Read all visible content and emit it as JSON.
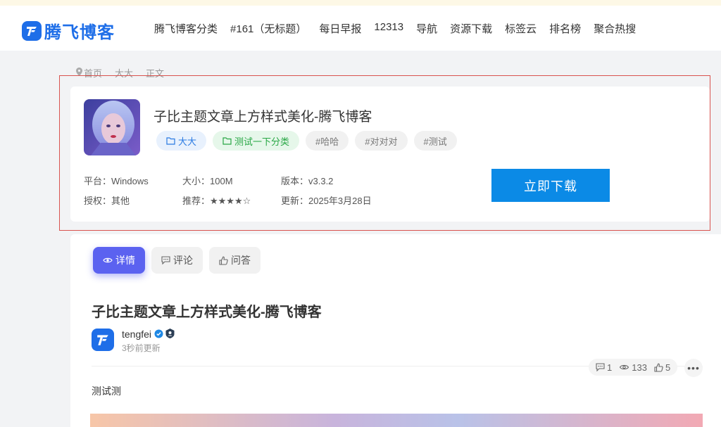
{
  "header": {
    "logo_text": "腾飞博客",
    "nav": [
      "腾飞博客分类",
      "#161（无标题）",
      "每日早报",
      "12313",
      "导航",
      "资源下载",
      "标签云",
      "排名榜",
      "聚合热搜"
    ]
  },
  "breadcrumb": [
    "首页",
    "大大",
    "正文"
  ],
  "download_card": {
    "title": "子比主题文章上方样式美化-腾飞博客",
    "tags": [
      {
        "label": "大大",
        "style": "blue",
        "icon": "folder-icon"
      },
      {
        "label": "测试一下分类",
        "style": "green",
        "icon": "folder-icon"
      },
      {
        "label": "#哈哈",
        "style": "gray"
      },
      {
        "label": "#对对对",
        "style": "gray"
      },
      {
        "label": "#测试",
        "style": "gray"
      }
    ],
    "platform": "平台：Windows",
    "size": "大小：100M",
    "version": "版本：v3.3.2",
    "license": "授权：其他",
    "rating": "推荐：★★★★☆",
    "updated": "更新：2025年3月28日",
    "download_label": "立即下载"
  },
  "article": {
    "tabs": [
      {
        "label": "详情",
        "icon": "eye-icon",
        "active": true
      },
      {
        "label": "评论",
        "icon": "comment-icon",
        "active": false
      },
      {
        "label": "问答",
        "icon": "thumb-icon",
        "active": false
      }
    ],
    "title": "子比主题文章上方样式美化-腾飞博客",
    "author": "tengfei",
    "updated": "3秒前更新",
    "stats": {
      "comments": "1",
      "views": "133",
      "likes": "5"
    },
    "more_label": "•••",
    "body": "测试测"
  },
  "colors": {
    "brand": "#1e6ee8",
    "download_button": "#0b8ae6",
    "active_tab": "#5b62f0",
    "highlight_border": "#d9534f"
  }
}
